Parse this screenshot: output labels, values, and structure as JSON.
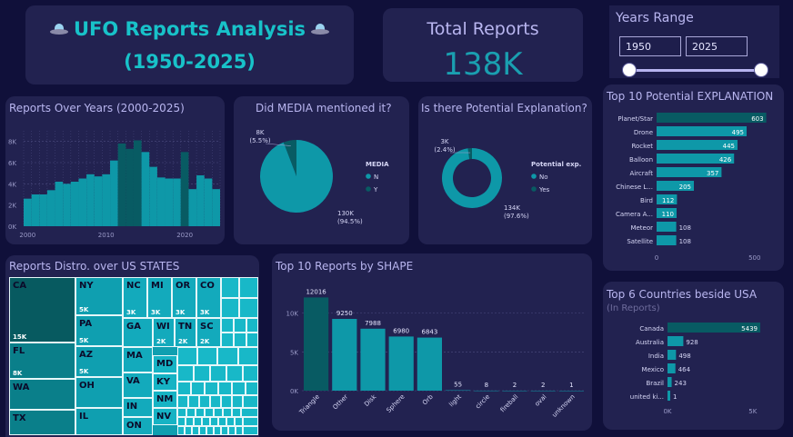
{
  "header": {
    "title_line1": "UFO Reports Analysis",
    "title_line2": "(1950-2025)"
  },
  "kpi": {
    "label": "Total Reports",
    "value": "138K"
  },
  "years": {
    "label": "Years Range",
    "start": "1950",
    "end": "2025"
  },
  "colors": {
    "teal": "#0e98a8",
    "dark_teal": "#085b63",
    "bg": "#10103a",
    "card": "#222250",
    "title": "#b9b6f0"
  },
  "chart_data": [
    {
      "type": "bar",
      "title": "Reports Over Years (2000-2025)",
      "x": [
        2000,
        2001,
        2002,
        2003,
        2004,
        2005,
        2006,
        2007,
        2008,
        2009,
        2010,
        2011,
        2012,
        2013,
        2014,
        2015,
        2016,
        2017,
        2018,
        2019,
        2020,
        2021,
        2022,
        2023,
        2024
      ],
      "values": [
        2600,
        3000,
        3000,
        3400,
        4200,
        4000,
        4200,
        4500,
        4900,
        4700,
        4900,
        6200,
        7800,
        7300,
        8100,
        7000,
        5600,
        4600,
        4500,
        4500,
        7000,
        3500,
        4800,
        4500,
        3500
      ],
      "highlight_years": [
        2012,
        2013,
        2014,
        2020
      ],
      "xticks": [
        "2000",
        "2010",
        "2020"
      ],
      "yticks": [
        "0K",
        "2K",
        "4K",
        "6K",
        "8K"
      ],
      "ylim": [
        0,
        9000
      ]
    },
    {
      "type": "pie",
      "title": "Did MEDIA mentioned it?",
      "legend_title": "MEDIA",
      "slices": [
        {
          "name": "N",
          "value": 130,
          "label": "130K",
          "pct": "(94.5%)"
        },
        {
          "name": "Y",
          "value": 8,
          "label": "8K",
          "pct": "(5.5%)"
        }
      ]
    },
    {
      "type": "pie",
      "title": "Is there Potential Explanation?",
      "legend_title": "Potential exp.",
      "slices": [
        {
          "name": "No",
          "value": 134,
          "label": "134K",
          "pct": "(97.6%)"
        },
        {
          "name": "Yes",
          "value": 3,
          "label": "3K",
          "pct": "(2.4%)"
        }
      ]
    },
    {
      "type": "bar",
      "title": "Top 10 Potential EXPLANATION",
      "orientation": "horizontal",
      "categories": [
        "Planet/Star",
        "Drone",
        "Rocket",
        "Balloon",
        "Aircraft",
        "Chinese L...",
        "Bird",
        "Camera A...",
        "Meteor",
        "Satellite"
      ],
      "values": [
        603,
        495,
        445,
        426,
        357,
        205,
        112,
        110,
        108,
        108
      ],
      "xticks": [
        "0",
        "500"
      ],
      "xlim": [
        0,
        650
      ]
    },
    {
      "type": "heatmap",
      "title": "Reports Distro. over US STATES",
      "cells": [
        {
          "name": "CA",
          "label": "15K"
        },
        {
          "name": "FL",
          "label": "8K"
        },
        {
          "name": "WA",
          "label": ""
        },
        {
          "name": "TX",
          "label": ""
        },
        {
          "name": "NY",
          "label": "5K"
        },
        {
          "name": "PA",
          "label": "5K"
        },
        {
          "name": "AZ",
          "label": "5K"
        },
        {
          "name": "OH",
          "label": ""
        },
        {
          "name": "IL",
          "label": ""
        },
        {
          "name": "NC",
          "label": "3K"
        },
        {
          "name": "MI",
          "label": "3K"
        },
        {
          "name": "OR",
          "label": "3K"
        },
        {
          "name": "CO",
          "label": "3K"
        },
        {
          "name": "GA",
          "label": ""
        },
        {
          "name": "WI",
          "label": "2K"
        },
        {
          "name": "TN",
          "label": "2K"
        },
        {
          "name": "SC",
          "label": "2K"
        },
        {
          "name": "MA",
          "label": ""
        },
        {
          "name": "MD",
          "label": ""
        },
        {
          "name": "VA",
          "label": ""
        },
        {
          "name": "KY",
          "label": ""
        },
        {
          "name": "NM",
          "label": ""
        },
        {
          "name": "IN",
          "label": ""
        },
        {
          "name": "NV",
          "label": ""
        },
        {
          "name": "ON",
          "label": ""
        }
      ]
    },
    {
      "type": "bar",
      "title": "Top 10 Reports by SHAPE",
      "categories": [
        "Triangle",
        "Other",
        "Disk",
        "Sphere",
        "Orb",
        "light",
        "circle",
        "fireball",
        "oval",
        "unknown"
      ],
      "values": [
        12016,
        9250,
        7988,
        6980,
        6843,
        55,
        8,
        2,
        2,
        1
      ],
      "yticks": [
        "0K",
        "5K",
        "10K"
      ],
      "ylim": [
        0,
        13000
      ]
    },
    {
      "type": "bar",
      "title": "Top 6 Countries beside USA",
      "subtitle": "(In Reports)",
      "orientation": "horizontal",
      "categories": [
        "Canada",
        "Australia",
        "India",
        "Mexico",
        "Brazil",
        "united ki..."
      ],
      "values": [
        5439,
        928,
        498,
        464,
        243,
        1
      ],
      "xticks": [
        "0K",
        "5K"
      ],
      "xlim": [
        0,
        5600
      ]
    }
  ]
}
